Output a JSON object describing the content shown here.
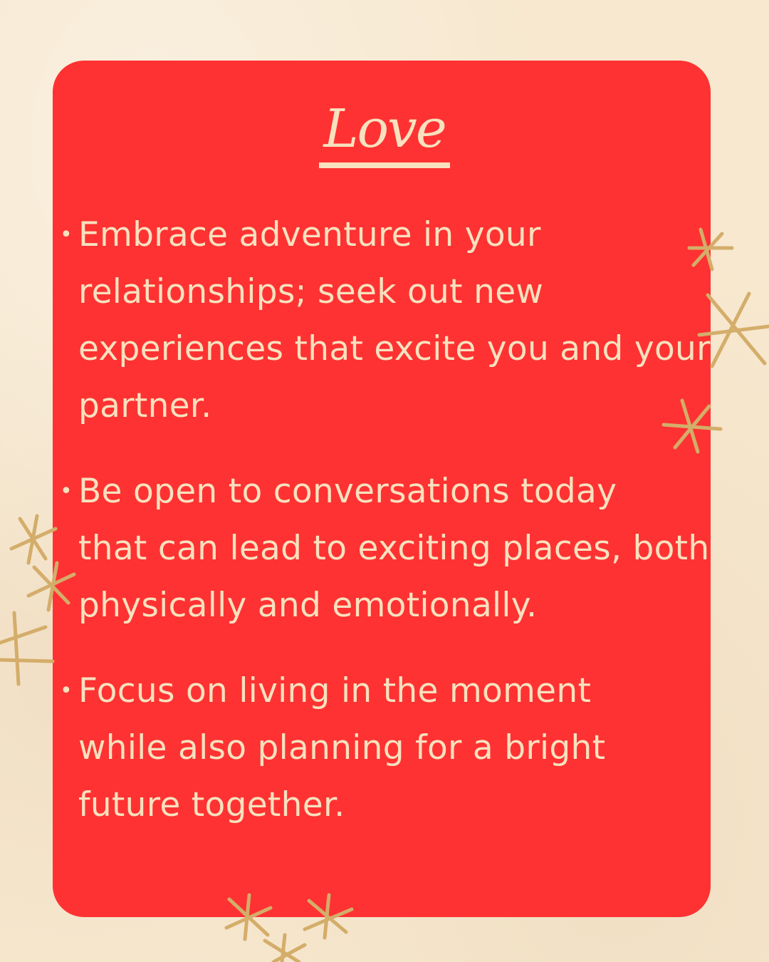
{
  "title": "Love",
  "bullets": [
    {
      "lines": [
        "Embrace adventure in your",
        "relationships; seek out new",
        "experiences that excite you and your",
        "partner."
      ]
    },
    {
      "lines": [
        "Be open to conversations today",
        "that can lead to exciting places, both",
        "physically and emotionally."
      ]
    },
    {
      "lines": [
        "Focus on living in the moment",
        "while also planning for a bright",
        "future together."
      ]
    }
  ],
  "bullet_symbol": "•",
  "colors": {
    "background": "#f7e8cf",
    "card": "#fe3232",
    "text": "#f8e1bf",
    "star": "#d4ad6a"
  },
  "decorations": [
    "sparkle-star-icon"
  ]
}
